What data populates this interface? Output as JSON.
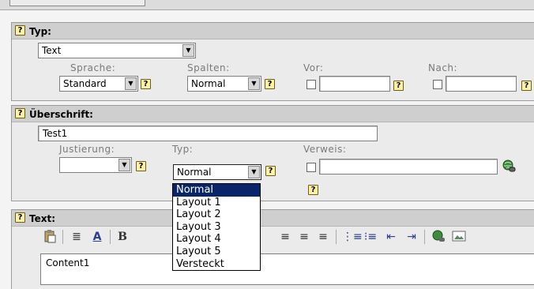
{
  "section_typ": {
    "title": "Typ:",
    "type_value": "Text",
    "sprache_label": "Sprache:",
    "sprache_value": "Standard",
    "spalten_label": "Spalten:",
    "spalten_value": "Normal",
    "vor_label": "Vor:",
    "nach_label": "Nach:"
  },
  "section_ueberschrift": {
    "title": "Überschrift:",
    "heading_value": "Test1",
    "justierung_label": "Justierung:",
    "justierung_value": "",
    "typ_label": "Typ:",
    "typ_value": "Normal",
    "verweis_label": "Verweis:"
  },
  "typ_dropdown": {
    "options": [
      "Normal",
      "Layout 1",
      "Layout 2",
      "Layout 3",
      "Layout 4",
      "Layout 5",
      "Versteckt"
    ],
    "selected": "Normal"
  },
  "section_text": {
    "title": "Text:",
    "content": "Content1",
    "toolbar": {
      "bold_label": "B",
      "icons": [
        "paste-icon",
        "paragraph-format-icon",
        "font-color-icon",
        "bold-icon",
        "align-center-icon",
        "align-justify-icon",
        "align-right-icon",
        "ordered-list-icon",
        "unordered-list-icon",
        "outdent-icon",
        "indent-icon",
        "insert-link-icon",
        "insert-image-icon"
      ]
    }
  },
  "help_icon_glyph": "?",
  "colors": {
    "header_bg": "#cfcfcf",
    "section_bg": "#ebebeb",
    "selection": "#0a246a",
    "help_icon_bg": "#fff2a8"
  }
}
